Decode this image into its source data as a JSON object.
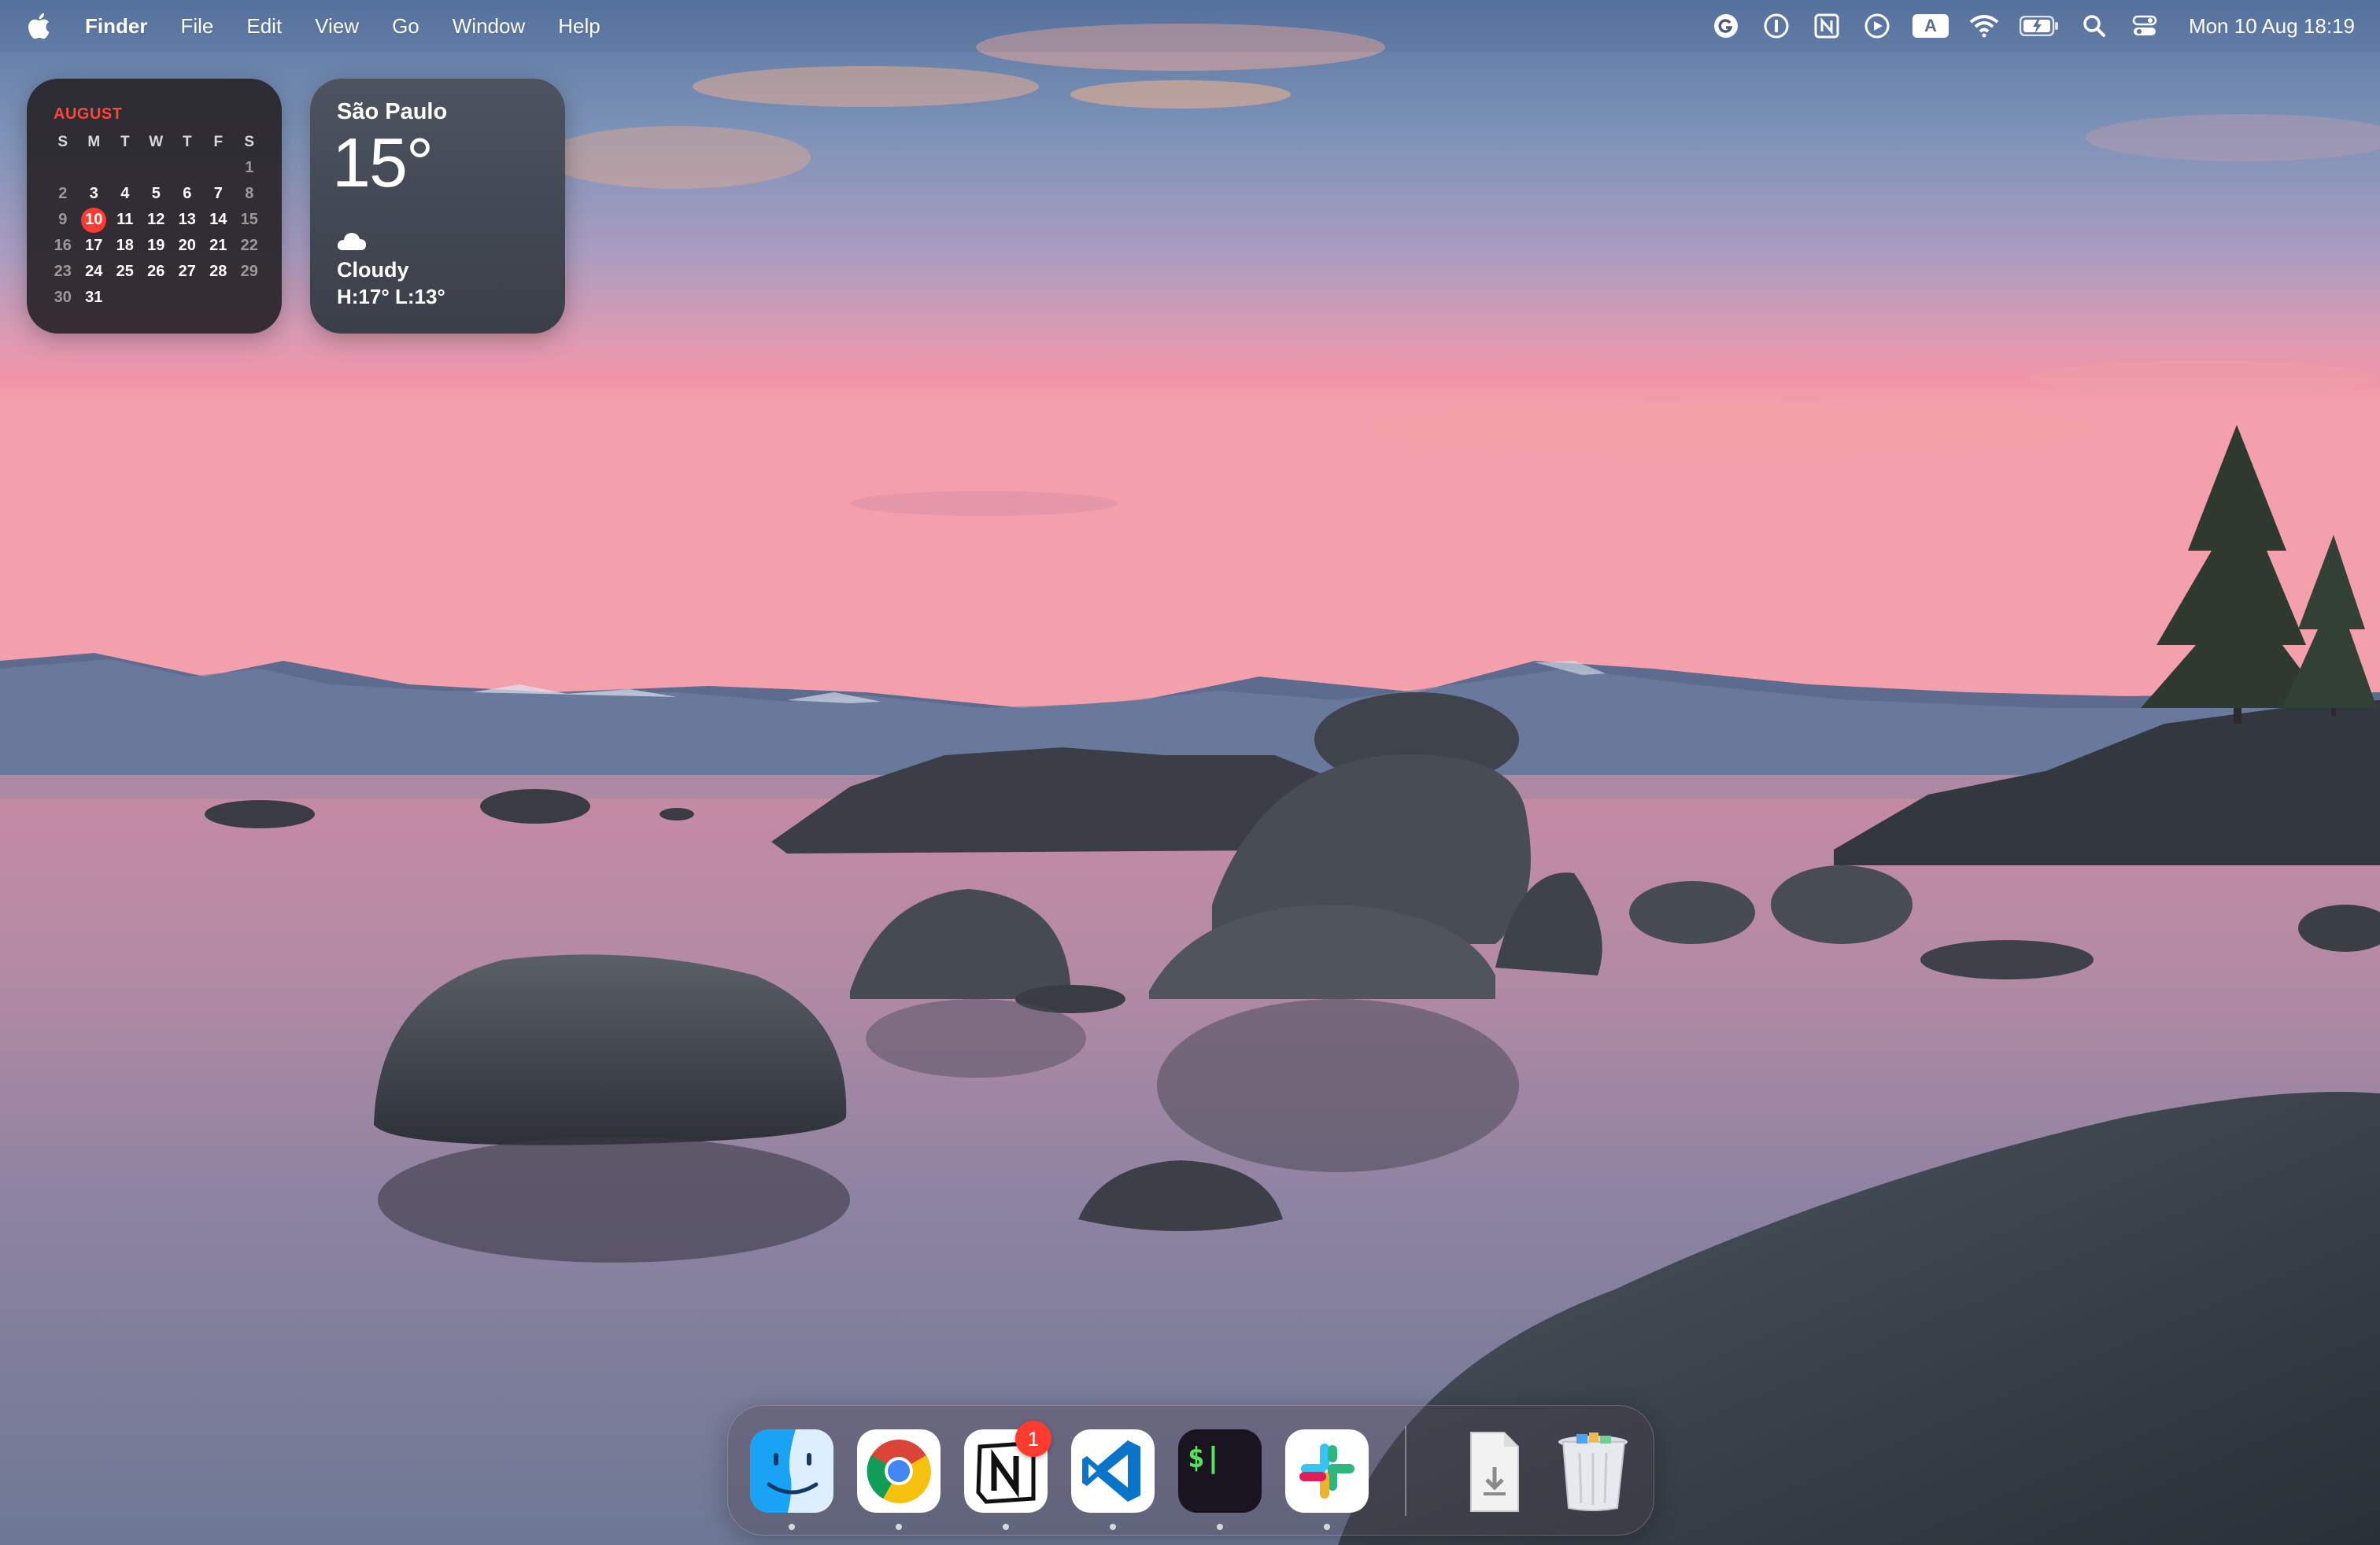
{
  "menubar": {
    "app_name": "Finder",
    "menus": [
      "File",
      "Edit",
      "View",
      "Go",
      "Window",
      "Help"
    ],
    "status_icons": [
      "grammarly-icon",
      "onepassword-icon",
      "notion-icon",
      "play-icon",
      "input-source-icon",
      "wifi-icon",
      "battery-icon",
      "spotlight-search-icon",
      "control-center-icon"
    ],
    "input_source_label": "A",
    "clock": "Mon 10 Aug  18:19"
  },
  "calendar_widget": {
    "month": "AUGUST",
    "weekday_headers": [
      "S",
      "M",
      "T",
      "W",
      "T",
      "F",
      "S"
    ],
    "weeks": [
      [
        "",
        "",
        "",
        "",
        "",
        "",
        "1"
      ],
      [
        "2",
        "3",
        "4",
        "5",
        "6",
        "7",
        "8"
      ],
      [
        "9",
        "10",
        "11",
        "12",
        "13",
        "14",
        "15"
      ],
      [
        "16",
        "17",
        "18",
        "19",
        "20",
        "21",
        "22"
      ],
      [
        "23",
        "24",
        "25",
        "26",
        "27",
        "28",
        "29"
      ],
      [
        "30",
        "31",
        "",
        "",
        "",
        "",
        ""
      ]
    ],
    "today": "10",
    "accent_color": "#ff3b30"
  },
  "weather_widget": {
    "city": "São Paulo",
    "temperature": "15°",
    "condition": "Cloudy",
    "high_low": "H:17° L:13°",
    "condition_icon": "cloud-icon"
  },
  "dock": {
    "apps": [
      {
        "name": "Finder",
        "icon": "finder-icon",
        "running": true
      },
      {
        "name": "Google Chrome",
        "icon": "chrome-icon",
        "running": true
      },
      {
        "name": "Notion",
        "icon": "notion-icon",
        "running": true,
        "badge": "1"
      },
      {
        "name": "Visual Studio Code",
        "icon": "vscode-icon",
        "running": true
      },
      {
        "name": "Terminal",
        "icon": "terminal-icon",
        "running": true
      },
      {
        "name": "Slack",
        "icon": "slack-icon",
        "running": true
      }
    ],
    "others": [
      {
        "name": "Downloads",
        "icon": "downloads-stack-icon"
      },
      {
        "name": "Trash",
        "icon": "trash-icon"
      }
    ],
    "notion_badge": "1",
    "terminal_prompt": "$|"
  },
  "colors": {
    "sky_top": "#5f7fa8",
    "sky_pink": "#e89ab0",
    "water": "#8f7f9f",
    "today_highlight": "#ff3b30"
  }
}
